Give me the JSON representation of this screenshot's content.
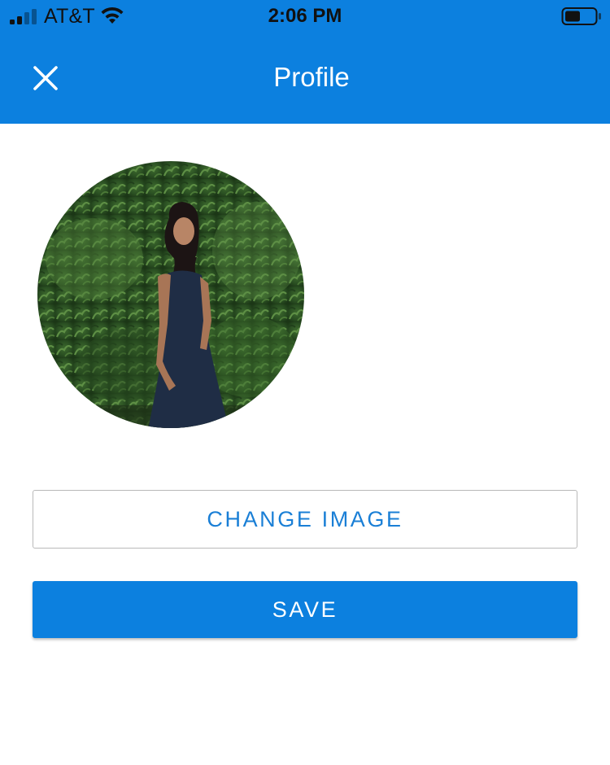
{
  "status_bar": {
    "carrier": "AT&T",
    "time": "2:06 PM",
    "signal_bars_active": 2,
    "signal_bars_total": 4,
    "battery_level": 0.5
  },
  "navbar": {
    "title": "Profile",
    "close_icon": "close-icon"
  },
  "profile": {
    "avatar_alt": "profile-photo"
  },
  "actions": {
    "change_image_label": "CHANGE IMAGE",
    "save_label": "SAVE"
  },
  "colors": {
    "primary": "#0c80df",
    "outline_text": "#1a7fd6",
    "outline_border": "#b9b9b9"
  }
}
